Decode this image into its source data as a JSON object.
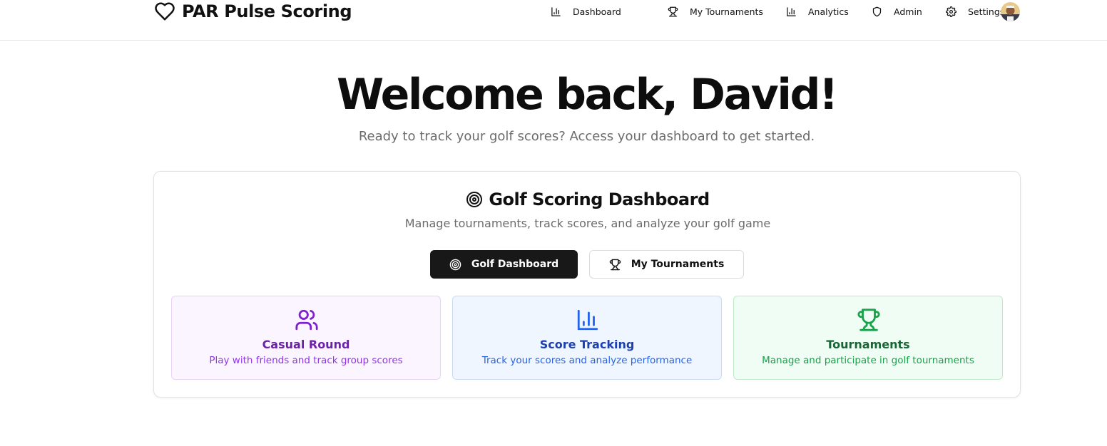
{
  "header": {
    "brand": "PAR Pulse Scoring",
    "nav": [
      {
        "label": "Dashboard",
        "icon": "bar-chart-icon"
      },
      {
        "label": "My Tournaments",
        "icon": "trophy-icon"
      },
      {
        "label": "Analytics",
        "icon": "bar-chart-icon"
      },
      {
        "label": "Admin",
        "icon": "shield-icon"
      },
      {
        "label": "Settings",
        "icon": "gear-icon"
      }
    ]
  },
  "hero": {
    "title": "Welcome back, David!",
    "subtitle": "Ready to track your golf scores? Access your dashboard to get started."
  },
  "card": {
    "title": "Golf Scoring Dashboard",
    "subtitle": "Manage tournaments, track scores, and analyze your golf game",
    "buttons": [
      {
        "label": "Golf Dashboard",
        "icon": "target-icon"
      },
      {
        "label": "My Tournaments",
        "icon": "trophy-icon"
      }
    ],
    "features": [
      {
        "title": "Casual Round",
        "desc": "Play with friends and track group scores",
        "icon": "users-icon",
        "color": "#7e22ce",
        "title_color": "#6b21a8"
      },
      {
        "title": "Score Tracking",
        "desc": "Track your scores and analyze performance",
        "icon": "bar-chart-icon",
        "color": "#2563eb",
        "title_color": "#1e40af"
      },
      {
        "title": "Tournaments",
        "desc": "Manage and participate in golf tournaments",
        "icon": "trophy-icon",
        "color": "#16a34a",
        "title_color": "#166534"
      }
    ]
  },
  "colors": {
    "primary_button": "#181818",
    "muted_text": "#6b6b6b"
  }
}
